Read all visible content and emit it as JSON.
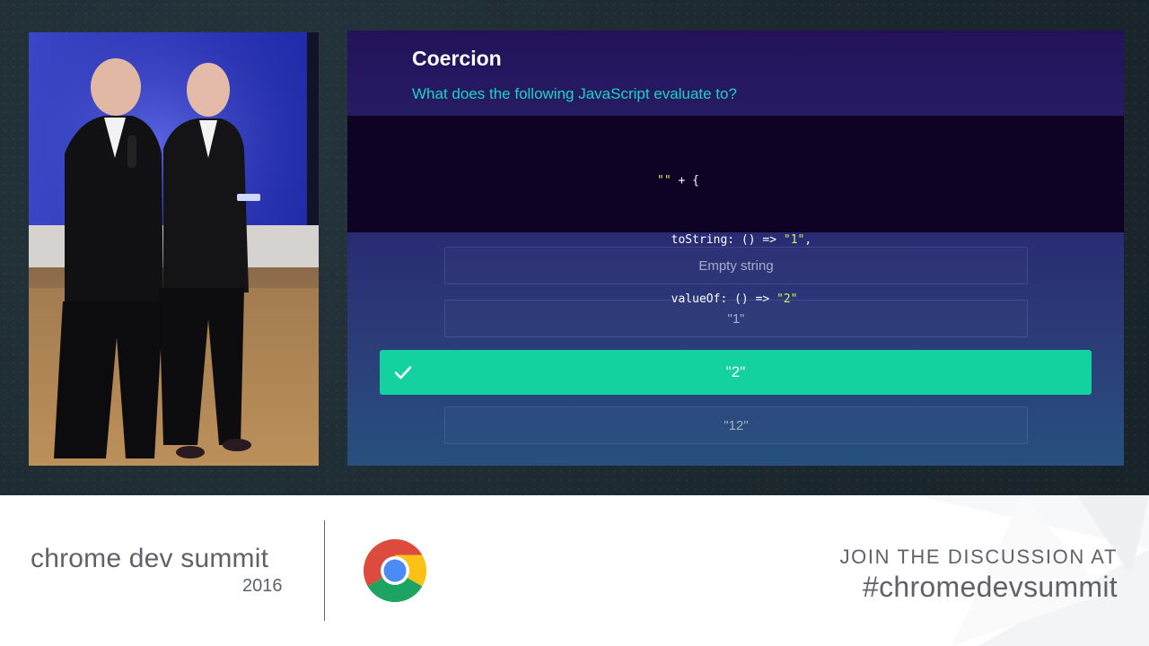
{
  "slide": {
    "title": "Coercion",
    "question": "What does the following JavaScript evaluate to?",
    "code": {
      "line1": {
        "str": "\"\"",
        "rest": " + {"
      },
      "line2": {
        "pre": "  toString: () => ",
        "str": "\"1\"",
        "post": ","
      },
      "line3": {
        "pre": "  valueOf: () => ",
        "str": "\"2\""
      },
      "line4": "};"
    },
    "answers": {
      "a1": "Empty string",
      "a2": "\"1\"",
      "a3": "\"2\"",
      "a4": "\"12\""
    },
    "correct_answer": "a3",
    "check_icon": "checkmark-icon"
  },
  "branding": {
    "event_name": "chrome dev summit",
    "event_year": "2016",
    "logo": "chrome-logo-icon",
    "join_text": "JOIN THE DISCUSSION AT",
    "hashtag": "#chromedevsummit"
  },
  "colors": {
    "accent_teal": "#20d2c5",
    "correct_green": "#14d1a0",
    "code_string": "#cff26a",
    "brand_gray": "#5f6368"
  }
}
